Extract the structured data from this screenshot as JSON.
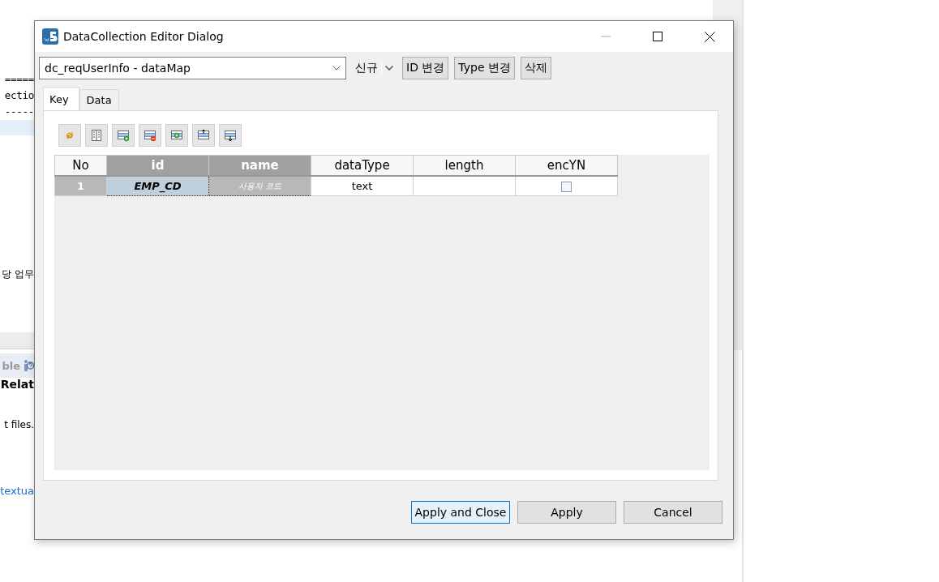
{
  "background": {
    "texts": [
      {
        "kind": "mono",
        "text": "====="
      },
      {
        "kind": "mono",
        "text": "ectio"
      },
      {
        "kind": "mono",
        "text": "-----"
      },
      {
        "kind": "highlight"
      },
      {
        "kind": "plain",
        "text": "당 업무"
      },
      {
        "kind": "bar"
      },
      {
        "kind": "tab",
        "text": "ble"
      },
      {
        "kind": "bold",
        "text": "Relat"
      },
      {
        "kind": "plain",
        "text": "t files."
      },
      {
        "kind": "link",
        "text": "textua"
      }
    ]
  },
  "dialog": {
    "title": "DataCollection Editor Dialog",
    "source": {
      "value": "dc_reqUserInfo - dataMap"
    },
    "new_menu": {
      "label": "신규"
    },
    "buttons": [
      "ID 변경",
      "Type 변경",
      "삭제"
    ],
    "tabs": [
      {
        "label": "Key",
        "selected": true
      },
      {
        "label": "Data",
        "selected": false
      }
    ],
    "table": {
      "columns": [
        {
          "label": "No",
          "highlighted": false
        },
        {
          "label": "id",
          "highlighted": true
        },
        {
          "label": "name",
          "highlighted": true
        },
        {
          "label": "dataType",
          "highlighted": false
        },
        {
          "label": "length",
          "highlighted": false
        },
        {
          "label": "encYN",
          "highlighted": false
        }
      ],
      "rows": [
        {
          "no": "1",
          "id": "EMP_CD",
          "name": "사용자 코드",
          "data_type": "text",
          "enc_yn": false
        }
      ]
    },
    "footer_buttons": [
      {
        "label": "Apply and Close",
        "focused": true
      },
      {
        "label": "Apply",
        "focused": false
      },
      {
        "label": "Cancel",
        "focused": false
      }
    ]
  }
}
